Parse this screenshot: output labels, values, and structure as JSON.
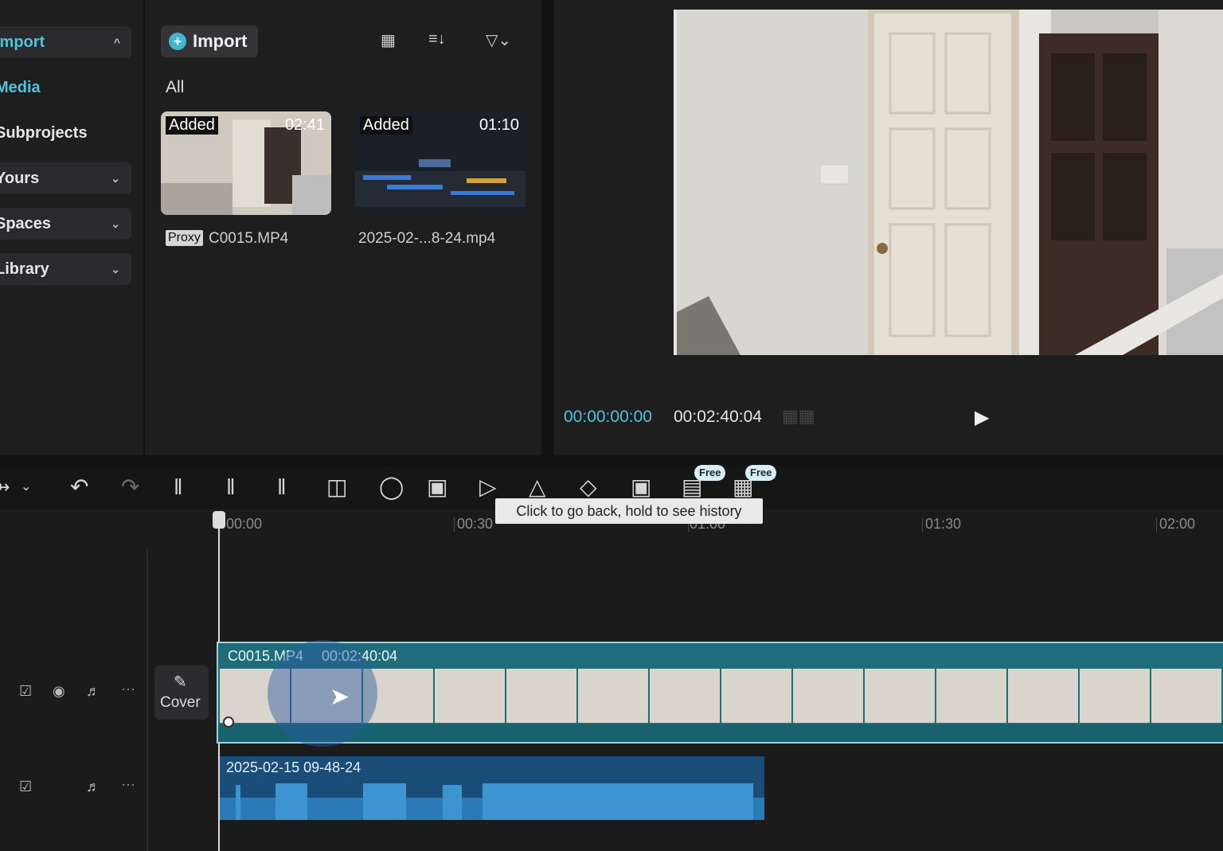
{
  "nav": {
    "items": [
      {
        "label": "Import",
        "active": true,
        "chevron": "up"
      },
      {
        "label": "Media",
        "active": true
      },
      {
        "label": "Subprojects"
      },
      {
        "label": "Yours",
        "chevron": "down"
      },
      {
        "label": "Spaces",
        "chevron": "down"
      },
      {
        "label": "Library",
        "chevron": "down"
      }
    ]
  },
  "media": {
    "import_label": "Import",
    "filter_label": "All",
    "items": [
      {
        "added": "Added",
        "duration": "02:41",
        "proxy": "Proxy",
        "name": "C0015.MP4"
      },
      {
        "added": "Added",
        "duration": "01:10",
        "name": "2025-02-...8-24.mp4"
      }
    ]
  },
  "player": {
    "current_time": "00:00:00:00",
    "total_time": "00:02:40:04"
  },
  "toolbar": {
    "free_badge": "Free",
    "tooltip": "Click to go back, hold to see history"
  },
  "timeline": {
    "ruler": [
      "00:00",
      "00:30",
      "01:00",
      "01:30",
      "02:00"
    ],
    "cover_label": "Cover",
    "video_clip": {
      "name": "C0015.MP4",
      "duration": "00:02:40:04"
    },
    "audio_clip": {
      "name": "2025-02-15 09-48-24"
    }
  },
  "colors": {
    "accent": "#4fc3d9",
    "video_clip": "#1f6d7a",
    "audio_clip": "#1a4d78"
  }
}
